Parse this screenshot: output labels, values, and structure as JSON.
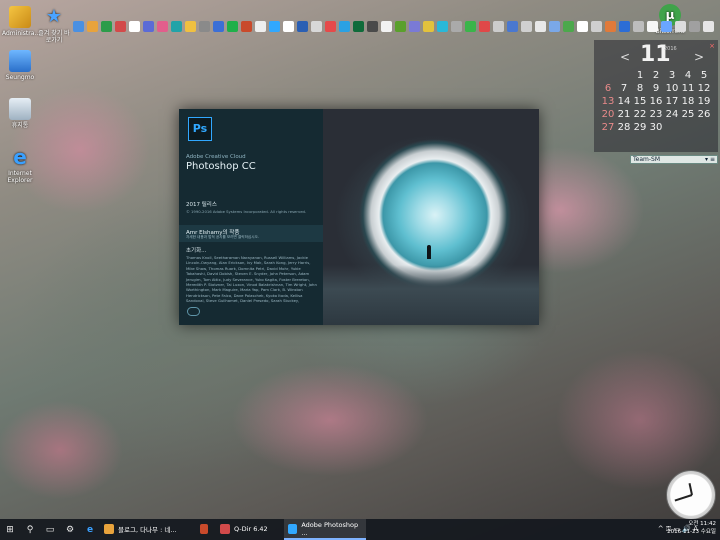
{
  "desktop": {
    "icons": [
      {
        "label": "Administra..."
      },
      {
        "label": "즐겨 찾기 바로가기"
      },
      {
        "label": "Seungmo"
      },
      {
        "label": "휴지통"
      },
      {
        "label": "Internet Explorer"
      },
      {
        "label": "Bittorrent"
      }
    ]
  },
  "calendar": {
    "month": "11",
    "year": "2016",
    "prev": "<",
    "next": ">",
    "close": "×",
    "days": [
      "",
      "",
      "1",
      "2",
      "3",
      "4",
      "5",
      "6",
      "7",
      "8",
      "9",
      "10",
      "11",
      "12",
      "13",
      "14",
      "15",
      "16",
      "17",
      "18",
      "19",
      "20",
      "21",
      "22",
      "23",
      "24",
      "25",
      "26",
      "27",
      "28",
      "29",
      "30",
      "",
      "",
      ""
    ]
  },
  "teambar": {
    "label": "Team-SM",
    "controls": "▾ ≡"
  },
  "splash": {
    "logo": "Ps",
    "brand": "Adobe Creative Cloud",
    "product": "Photoshop CC",
    "version_title": "2017 릴리스",
    "copyright": "© 1990-2016 Adobe Systems Incorporated. All rights reserved.",
    "author_title": "Amr Elshamy의 작품",
    "author_sub": "자세한 내용과 법적 공지를 보려면 클릭하십시오.",
    "loading": "초기화...",
    "credits": "Thomas Knoll, Seetharaman Narayanan, Russell Williams, Jackie Lincoln-Owyang, Alan Erickson, Ivy Mak, Sarah Kong, Jerry Harris, Mike Shaw, Thomas Ruark, Domnita Petri, David Mohr, Yukie Takahashi, David Dobish, Steven E. Snyder, John Peterson, Adam Jerugim, Tom Attix, Judy Severance, Yuko Kagita, Foster Brereton, Meredith P. Stotzner, Tai Luxon, Vinod Balakrishnan, Tim Wright, John Worthington, Mark Maguire, Maria Yap, Pam Clark, B. Winston Hendrickson, Pete Falco, Dave Polaschek, Kyoko Itoda, Kellisa Sandoval, Steve Guilhamet, Daniel Presedo, Sarah Stuckey,"
  },
  "taskbar": {
    "apps": [
      {
        "label": "블로그, 다나무 : 네...",
        "active": false,
        "color": "#e8a33c"
      },
      {
        "label": "",
        "active": false,
        "color": "#c94a2b"
      },
      {
        "label": "Q-Dir 6.42",
        "active": false,
        "color": "#d24a4a"
      },
      {
        "label": "Adobe Photoshop ...",
        "active": true,
        "color": "#31a8ff"
      }
    ],
    "tray_icons": "^ ⚿ ▭ 🔊 A",
    "time": "오전 11:42",
    "date": "2016-11-23 수요일"
  },
  "colors": {
    "accent": "#31a8ff",
    "taskbar": "#14181e",
    "splash_panel": "#152a32"
  }
}
